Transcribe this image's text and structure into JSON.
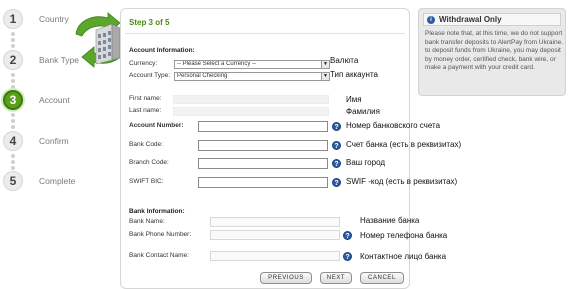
{
  "steps": [
    {
      "num": "1",
      "label": "Country"
    },
    {
      "num": "2",
      "label": "Bank Type"
    },
    {
      "num": "3",
      "label": "Account"
    },
    {
      "num": "4",
      "label": "Confirm"
    },
    {
      "num": "5",
      "label": "Complete"
    }
  ],
  "panel": {
    "step_title": "Step 3 of 5",
    "account_info_heading": "Account Information:",
    "currency_label": "Currency:",
    "currency_value": "-- Please Select a Currency --",
    "account_type_label": "Account Type:",
    "account_type_value": "Personal Checking",
    "first_name_label": "First name:",
    "last_name_label": "Last name:",
    "account_number_label": "Account Number:",
    "bank_code_label": "Bank Code:",
    "branch_code_label": "Branch Code:",
    "swift_label": "SWIFT BIC:",
    "bank_info_heading": "Bank Information:",
    "bank_name_label": "Bank Name:",
    "bank_phone_label": "Bank Phone Number:",
    "bank_contact_label": "Bank Contact Name:"
  },
  "annotations": {
    "currency": "Валюта",
    "account_type": "Тип аккаунта",
    "first_name": "Имя",
    "last_name": "Фамилия",
    "account_number": "Номер банковского счета",
    "bank_code": "Счет банка (есть в реквизитах)",
    "branch_code": "Ваш город",
    "swift": "SWIF -код (есть в реквизитах)",
    "bank_name": "Название банка",
    "bank_phone": "Номер телефона банка",
    "bank_contact": "Контактное лицо банка"
  },
  "buttons": {
    "previous": "PREVIOUS",
    "next": "NEXT",
    "cancel": "CANCEL"
  },
  "info_box": {
    "icon": "i",
    "title": "Withdrawal Only",
    "text": "Please note that, at this time, we do not support bank transfer deposits to AlertPay from Ukraine. to deposit funds from Ukraine, you may deposit by money order, certified check, bank wire, or make a payment with your credit card."
  },
  "help_glyph": "?",
  "colors": {
    "accent_green": "#5a9e1c",
    "title_green": "#4a8a12",
    "help_blue": "#2b5ca8"
  }
}
